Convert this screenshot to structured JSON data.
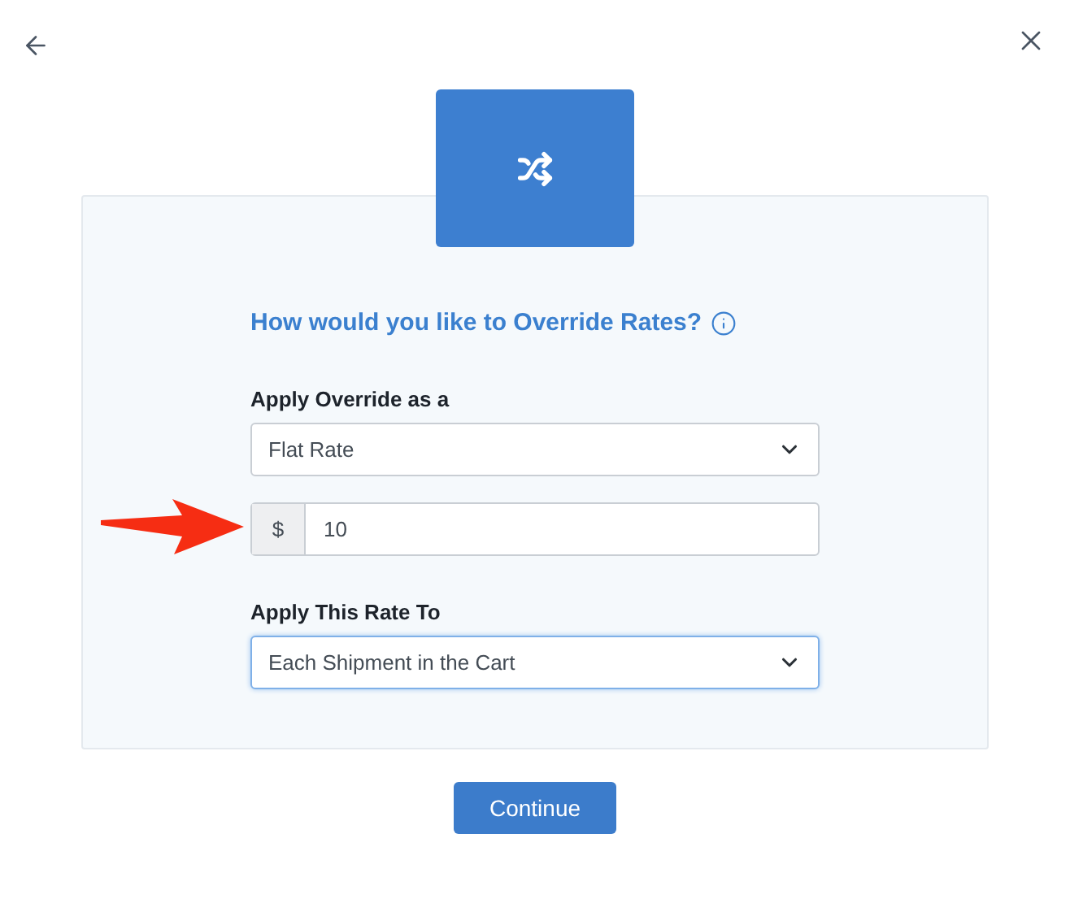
{
  "title": "How would you like to Override Rates?",
  "fields": [
    {
      "kind": "select",
      "label": "Apply Override as a",
      "value": "Flat Rate",
      "focused": false
    },
    {
      "kind": "amount",
      "prefix": "$",
      "value": "10",
      "focused": false
    },
    {
      "kind": "select",
      "label": "Apply This Rate To",
      "value": "Each Shipment in the Cart",
      "focused": true
    }
  ],
  "button": "Continue"
}
